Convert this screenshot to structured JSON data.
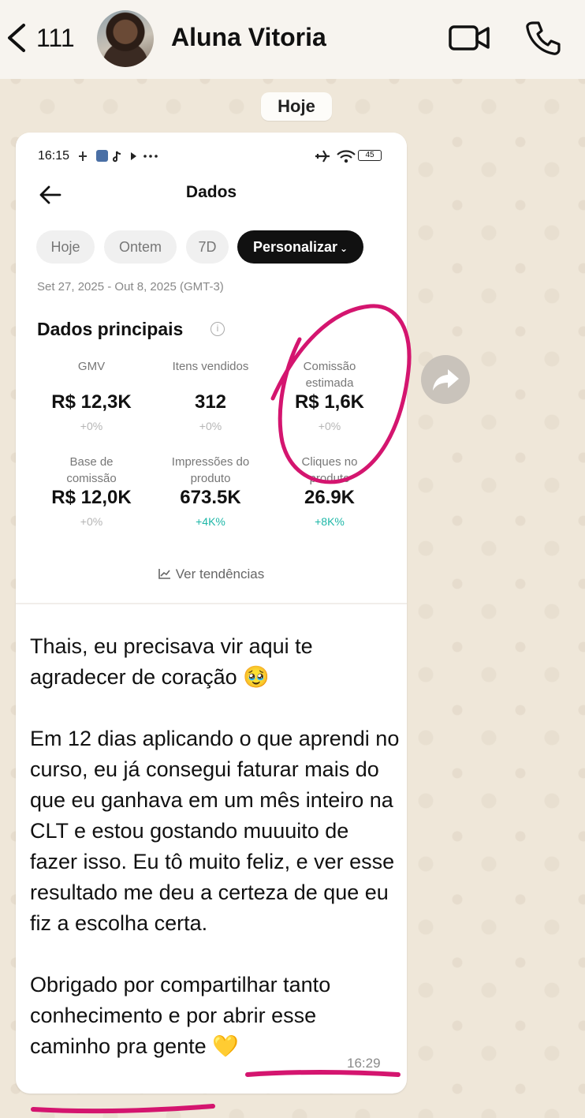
{
  "header": {
    "back_count": "111",
    "contact_name": "Aluna Vitoria",
    "icons": [
      "chevron-left-icon",
      "video-call-icon",
      "phone-icon"
    ]
  },
  "date_pill": "Hoje",
  "screenshot": {
    "status_time": "16:15",
    "battery": "45",
    "title": "Dados",
    "chips": [
      "Hoje",
      "Ontem",
      "7D",
      "Personalizar"
    ],
    "active_chip": "Personalizar",
    "date_range": "Set 27, 2025 - Out 8, 2025 (GMT-3)",
    "section_title": "Dados principais",
    "metrics": [
      {
        "label": "GMV",
        "value": "R$ 12,3K",
        "delta": "+0%"
      },
      {
        "label": "Itens vendidos",
        "value": "312",
        "delta": "+0%"
      },
      {
        "label": "Comissão estimada",
        "value": "R$ 1,6K",
        "delta": "+0%"
      },
      {
        "label": "Base de comissão",
        "value": "R$ 12,0K",
        "delta": "+0%"
      },
      {
        "label": "Impressões do produto",
        "value": "673.5K",
        "delta": "+4K%"
      },
      {
        "label": "Cliques no produto",
        "value": "26.9K",
        "delta": "+8K%"
      }
    ],
    "trend_link": "Ver tendências",
    "colors": {
      "delta_positive": "#1db7a7",
      "annotation": "#d4156f"
    }
  },
  "message": {
    "text": "Thais, eu precisava vir aqui te agradecer de coração 🥹\n\nEm 12 dias aplicando o que aprendi no curso, eu já consegui faturar mais do que eu ganhava em um mês inteiro na CLT e estou gostando muuuito de fazer isso. Eu tô muito feliz, e ver esse resultado me deu a certeza de que eu fiz a escolha certa.\n\nObrigado por compartilhar tanto conhecimento e por abrir esse caminho pra gente 💛",
    "time": "16:29"
  }
}
